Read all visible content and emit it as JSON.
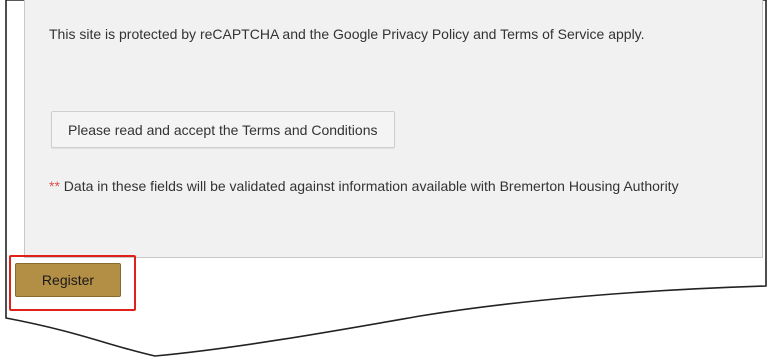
{
  "recaptcha_notice": {
    "prefix": "This site is protected by reCAPTCHA and the Google ",
    "privacy_link": "Privacy Policy",
    "middle": " and ",
    "terms_link": "Terms of Service",
    "suffix": " apply."
  },
  "terms_button_label": "Please read and accept the Terms and Conditions",
  "validation_note": {
    "asterisks": "**",
    "text": " Data in these fields will be validated against information available with Bremerton Housing Authority"
  },
  "register_button_label": "Register",
  "colors": {
    "panel_background": "#f1f1f1",
    "register_button": "#b38f45",
    "highlight_border": "#e0201b",
    "required_marker": "#d9534f"
  }
}
